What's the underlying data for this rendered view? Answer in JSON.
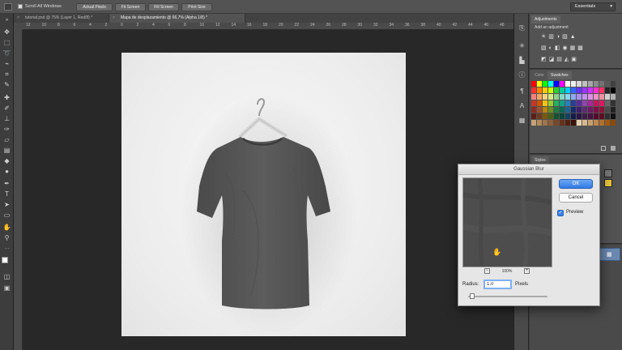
{
  "options_bar": {
    "scroll_all_label": "Scroll All Windows",
    "buttons": [
      "Actual Pixels",
      "Fit Screen",
      "Fill Screen",
      "Print Size"
    ],
    "workspace": "Essentials"
  },
  "tabs": [
    {
      "label": "tutorial.psd @ 75% (Layer 1, Red/8) *"
    },
    {
      "label": "Mapa de desplazamiento @ 66,7% (Alpha 1/8) *"
    }
  ],
  "ruler": [
    "12",
    "10",
    "8",
    "6",
    "4",
    "2",
    "0",
    "2",
    "4",
    "6",
    "8",
    "10",
    "12",
    "14",
    "16",
    "18",
    "20",
    "22",
    "24",
    "26",
    "28",
    "30",
    "32",
    "34",
    "36",
    "38",
    "40",
    "42",
    "44",
    "46",
    "48"
  ],
  "adjustments": {
    "tab": "Adjustments",
    "subtitle": "Add an adjustment"
  },
  "swatches": {
    "tabs": [
      "Color",
      "Swatches"
    ]
  },
  "styles": {
    "tab": "Styles"
  },
  "dialog": {
    "title": "Gaussian Blur",
    "ok_label": "OK",
    "cancel_label": "Cancel",
    "preview_label": "Preview",
    "preview_checked": true,
    "zoom_percent": "100%",
    "zoom_out": "−",
    "zoom_in": "+",
    "radius_label": "Radius:",
    "radius_value": "1.0",
    "radius_unit": "Pixels",
    "slider_level": 0.02
  },
  "colors": {
    "accent": "#2f7ae5",
    "panel": "#535353",
    "canvas_bg": "#282828",
    "shirt": "#555555"
  }
}
